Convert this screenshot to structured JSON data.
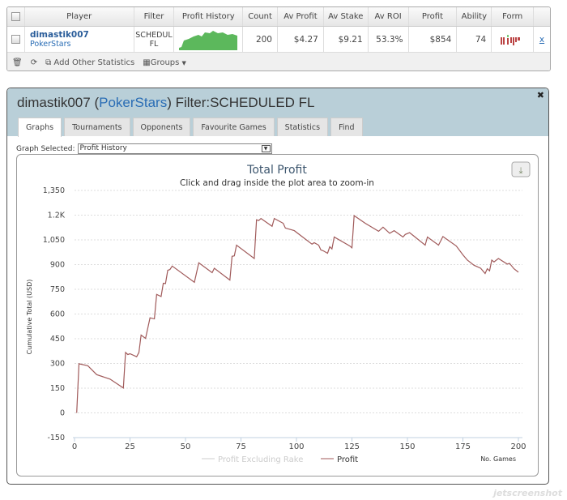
{
  "table": {
    "headers": [
      "Player",
      "Filter",
      "Profit History",
      "Count",
      "Av Profit",
      "Av Stake",
      "Av ROI",
      "Profit",
      "Ability",
      "Form"
    ],
    "row": {
      "player": "dimastik007",
      "site": "PokerStars",
      "filter_line1": "SCHEDUL",
      "filter_line2": "FL",
      "count": "200",
      "av_profit": "$4.27",
      "av_stake": "$9.21",
      "av_roi": "53.3%",
      "profit": "$854",
      "ability": "74",
      "remove": "x"
    },
    "toolbar": {
      "add_stats": "Add Other Statistics",
      "groups": "Groups"
    }
  },
  "panel": {
    "player": "dimastik007",
    "site": "PokerStars",
    "filter": "Filter:SCHEDULED FL",
    "tabs": [
      "Graphs",
      "Tournaments",
      "Opponents",
      "Favourite Games",
      "Statistics",
      "Find"
    ],
    "graph_label": "Graph Selected:",
    "graph_value": "Profit History"
  },
  "colors": {
    "profit_line": "#a05a5a",
    "sparkline": "#5cb85c",
    "panel_header": "#b9cfd8",
    "link": "#2a6db5"
  },
  "chart_data": {
    "type": "line",
    "title": "Total Profit",
    "subtitle": "Click and drag inside the plot area to zoom-in",
    "ylabel": "Cumulative Total (USD)",
    "xlabel": "No. Games",
    "xlim": [
      0,
      200
    ],
    "ylim": [
      -150,
      1350
    ],
    "xticks": [
      "0",
      "25",
      "50",
      "75",
      "100",
      "125",
      "150",
      "175",
      "200"
    ],
    "yticks": [
      "-150",
      "0",
      "150",
      "300",
      "450",
      "600",
      "750",
      "900",
      "1,050",
      "1.2K",
      "1,350"
    ],
    "grid": true,
    "legend_placement": "bottom",
    "legend": [
      "Profit Excluding Rake",
      "Profit"
    ],
    "series": [
      {
        "name": "Profit",
        "x": [
          1,
          2,
          6,
          10,
          16,
          22,
          23,
          24,
          25,
          28,
          29,
          30,
          32,
          34,
          36,
          37,
          39,
          40,
          41,
          42,
          43,
          44,
          54,
          56,
          62,
          63,
          70,
          71,
          72,
          73,
          81,
          82,
          83,
          84,
          89,
          90,
          94,
          95,
          99,
          107,
          108,
          110,
          111,
          112,
          114,
          115,
          116,
          117,
          124,
          125,
          126,
          131,
          137,
          139,
          142,
          144,
          148,
          149,
          151,
          158,
          159,
          164,
          166,
          172,
          175,
          177,
          180,
          183,
          185,
          186,
          187,
          188,
          189,
          191,
          195,
          196,
          198,
          200
        ],
        "y": [
          0,
          298,
          286,
          232,
          205,
          151,
          367,
          354,
          359,
          341,
          367,
          472,
          452,
          577,
          571,
          719,
          706,
          787,
          785,
          865,
          870,
          891,
          793,
          911,
          851,
          878,
          806,
          950,
          953,
          1018,
          937,
          1172,
          1167,
          1180,
          1132,
          1180,
          1151,
          1122,
          1106,
          1024,
          1033,
          1018,
          989,
          984,
          969,
          1008,
          995,
          1067,
          1013,
          1002,
          1197,
          1151,
          1102,
          1127,
          1090,
          1106,
          1067,
          1083,
          1094,
          1018,
          1067,
          1018,
          1070,
          1013,
          959,
          927,
          896,
          878,
          846,
          875,
          862,
          927,
          916,
          937,
          903,
          908,
          875,
          854
        ]
      }
    ]
  }
}
